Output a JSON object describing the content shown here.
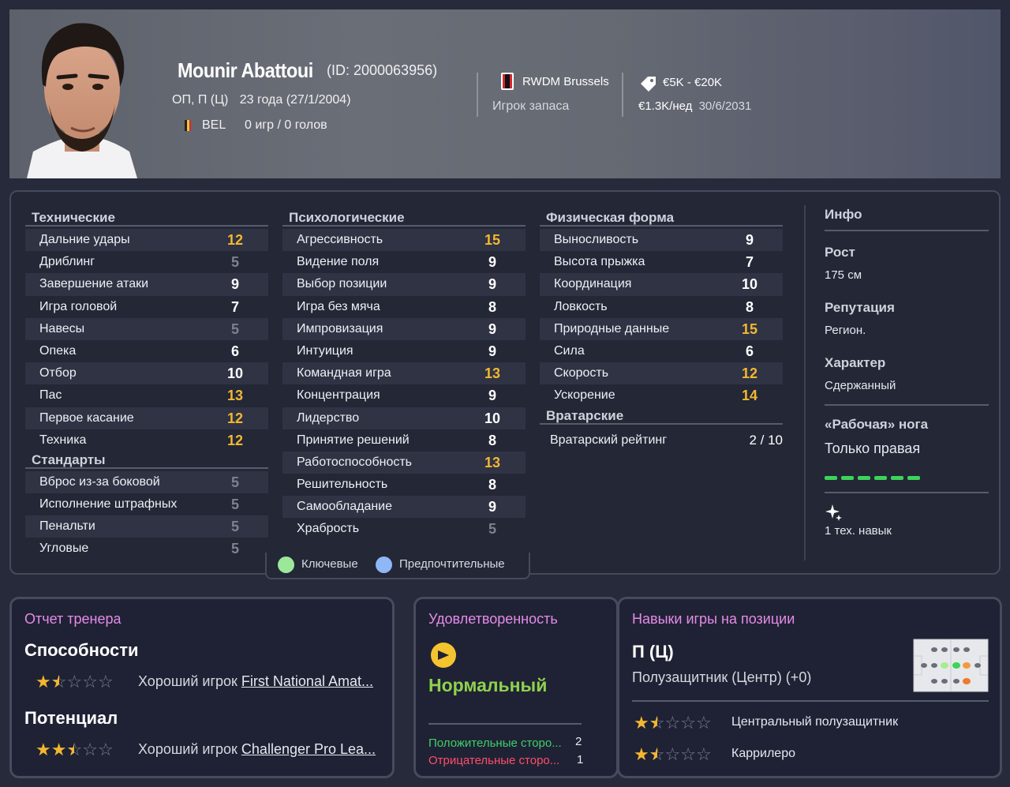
{
  "player": {
    "name": "Mounir Abattoui",
    "id_text": "(ID: 2000063956)",
    "positions": "ОП, П (Ц)",
    "age": "23 года (27/1/2004)",
    "nationality": "BEL",
    "caps": "0 игр / 0 голов",
    "club": "RWDM Brussels",
    "squad_status": "Игрок запаса",
    "value_range": "€5K - €20K",
    "wage": "€1.3K/нед",
    "contract_end": "30/6/2031"
  },
  "technical": {
    "title": "Технические",
    "rows": [
      {
        "label": "Дальние удары",
        "value": "12"
      },
      {
        "label": "Дриблинг",
        "value": "5"
      },
      {
        "label": "Завершение атаки",
        "value": "9"
      },
      {
        "label": "Игра головой",
        "value": "7"
      },
      {
        "label": "Навесы",
        "value": "5"
      },
      {
        "label": "Опека",
        "value": "6"
      },
      {
        "label": "Отбор",
        "value": "10"
      },
      {
        "label": "Пас",
        "value": "13"
      },
      {
        "label": "Первое касание",
        "value": "12"
      },
      {
        "label": "Техника",
        "value": "12"
      }
    ]
  },
  "set_pieces": {
    "title": "Стандарты",
    "rows": [
      {
        "label": "Вброс из-за боковой",
        "value": "5"
      },
      {
        "label": "Исполнение штрафных",
        "value": "5"
      },
      {
        "label": "Пенальти",
        "value": "5"
      },
      {
        "label": "Угловые",
        "value": "5"
      }
    ]
  },
  "mental": {
    "title": "Психологические",
    "rows": [
      {
        "label": "Агрессивность",
        "value": "15"
      },
      {
        "label": "Видение поля",
        "value": "9"
      },
      {
        "label": "Выбор позиции",
        "value": "9"
      },
      {
        "label": "Игра без мяча",
        "value": "8"
      },
      {
        "label": "Импровизация",
        "value": "9"
      },
      {
        "label": "Интуиция",
        "value": "9"
      },
      {
        "label": "Командная игра",
        "value": "13"
      },
      {
        "label": "Концентрация",
        "value": "9"
      },
      {
        "label": "Лидерство",
        "value": "10"
      },
      {
        "label": "Принятие решений",
        "value": "8"
      },
      {
        "label": "Работоспособность",
        "value": "13"
      },
      {
        "label": "Решительность",
        "value": "8"
      },
      {
        "label": "Самообладание",
        "value": "9"
      },
      {
        "label": "Храбрость",
        "value": "5"
      }
    ]
  },
  "physical": {
    "title": "Физическая форма",
    "rows": [
      {
        "label": "Выносливость",
        "value": "9"
      },
      {
        "label": "Высота прыжка",
        "value": "7"
      },
      {
        "label": "Координация",
        "value": "10"
      },
      {
        "label": "Ловкость",
        "value": "8"
      },
      {
        "label": "Природные данные",
        "value": "15"
      },
      {
        "label": "Сила",
        "value": "6"
      },
      {
        "label": "Скорость",
        "value": "12"
      },
      {
        "label": "Ускорение",
        "value": "14"
      }
    ]
  },
  "goalkeeping": {
    "title": "Вратарские",
    "rating_label": "Вратарский рейтинг",
    "rating_value": "2 / 10"
  },
  "legend": {
    "key_label": "Ключевые",
    "preferred_label": "Предпочтительные",
    "key_color": "#9be89b",
    "preferred_color": "#8fb7f5"
  },
  "info": {
    "title": "Инфо",
    "height_label": "Рост",
    "height_value": "175 см",
    "reputation_label": "Репутация",
    "reputation_value": "Регион.",
    "personality_label": "Характер",
    "personality_value": "Сдержанный",
    "foot_label": "«Рабочая» нога",
    "foot_value": "Только правая",
    "foot_level": 1.0,
    "traits_text": "1 тех. навык"
  },
  "coach_report": {
    "title": "Отчет тренера",
    "ability_label": "Способности",
    "ability_stars": 1.5,
    "ability_prefix": "Хороший игрок",
    "ability_league": "First National Amat...",
    "potential_label": "Потенциал",
    "potential_stars": 2.5,
    "potential_prefix": "Хороший игрок",
    "potential_league": "Challenger Pro Lea..."
  },
  "happiness": {
    "title": "Удовлетворенность",
    "status": "Нормальный",
    "positive_label": "Положительные сторо...",
    "positive_count": "2",
    "negative_label": "Отрицательные сторо...",
    "negative_count": "1"
  },
  "position_skills": {
    "title": "Навыки игры на позиции",
    "position": "П (Ц)",
    "position_desc": "Полузащитник (Центр) (+0)",
    "roles": [
      {
        "stars": 1.5,
        "label": "Центральный полузащитник"
      },
      {
        "stars": 1.5,
        "label": "Каррилеро"
      }
    ]
  },
  "colors": {
    "accent_orange": "#f4b730",
    "card_title": "#e58be8",
    "happy_green": "#8fd14f",
    "positive_green": "#3ecf6a",
    "negative_red": "#ff4d6a"
  }
}
